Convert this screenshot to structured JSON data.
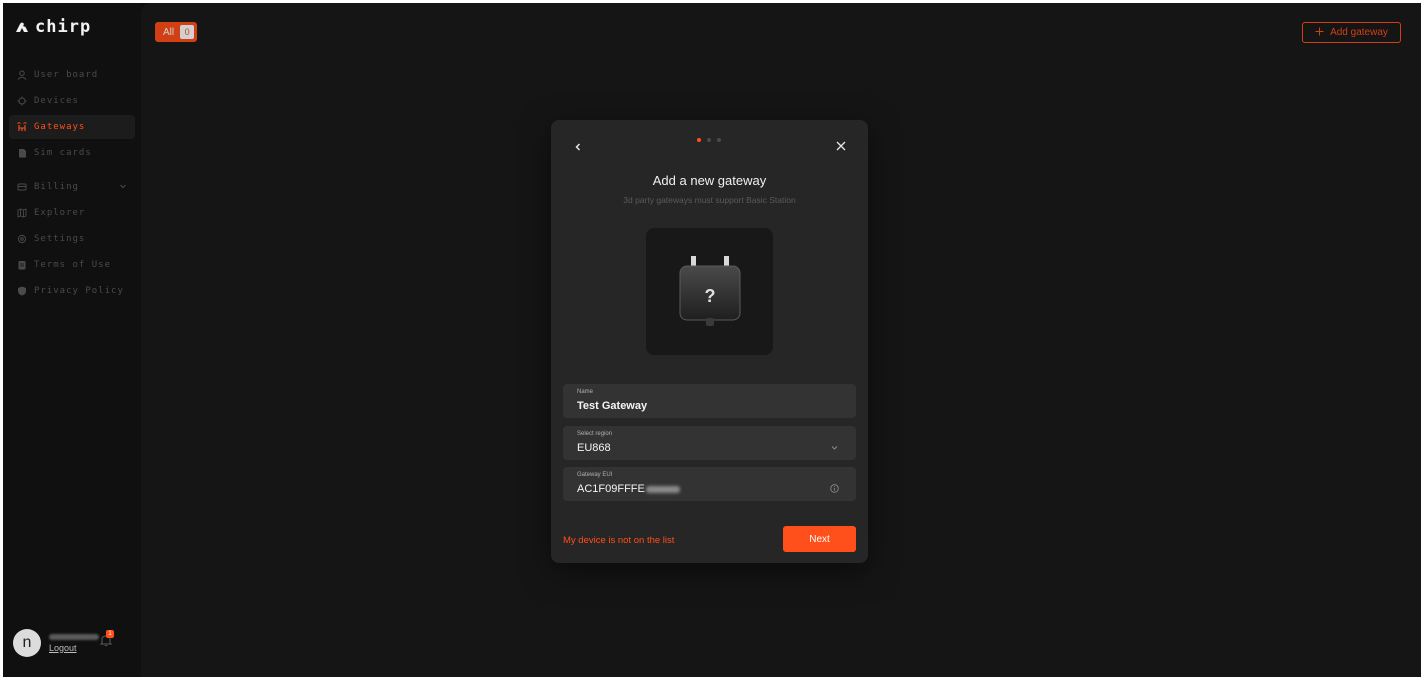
{
  "app": {
    "logo_text": "chirp"
  },
  "sidebar": {
    "items": [
      {
        "label": "User board",
        "icon": "user-icon"
      },
      {
        "label": "Devices",
        "icon": "device-icon"
      },
      {
        "label": "Gateways",
        "icon": "gateway-icon",
        "active": true
      },
      {
        "label": "Sim cards",
        "icon": "sim-card-icon"
      },
      {
        "label": "Billing",
        "icon": "billing-icon"
      },
      {
        "label": "Explorer",
        "icon": "map-icon"
      },
      {
        "label": "Settings",
        "icon": "gear-icon"
      },
      {
        "label": "Terms of Use",
        "icon": "document-icon"
      },
      {
        "label": "Privacy Policy",
        "icon": "shield-icon"
      }
    ],
    "user": {
      "avatar_letter": "n",
      "logout_label": "Logout",
      "notification_count": "1"
    }
  },
  "toolbar": {
    "filter_label": "All",
    "filter_count": "0",
    "add_gateway_label": "Add gateway"
  },
  "modal": {
    "title": "Add a new gateway",
    "subtitle": "3d party gateways must support Basic Station",
    "device_glyph": "?",
    "steps_total": 3,
    "step_current": 1,
    "fields": {
      "name": {
        "label": "Name",
        "value": "Test Gateway"
      },
      "region": {
        "label": "Select region",
        "value": "EU868"
      },
      "eui": {
        "label": "Gateway EUI",
        "value": "AC1F09FFFE"
      }
    },
    "not_on_list_label": "My device is not on the list",
    "next_label": "Next"
  },
  "colors": {
    "accent": "#ff4f1a",
    "background": "#1a1a1a",
    "sidebar": "#101010",
    "modal": "#262626"
  }
}
